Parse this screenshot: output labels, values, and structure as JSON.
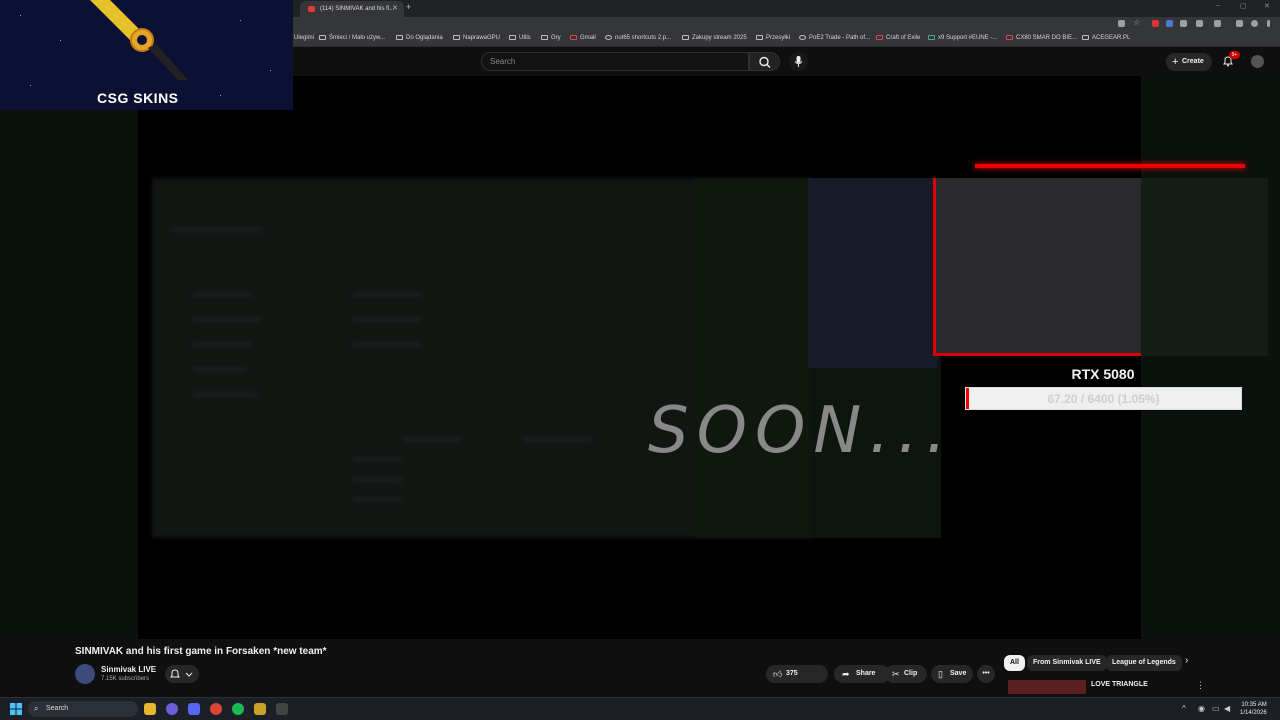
{
  "browser": {
    "tab_title": "(114) SINMIVAK and his fi...",
    "bookmarks": [
      "Ulegimi",
      "Śmieci / Mało używ...",
      "Do Oglądania",
      "NaprawaGPU",
      "Utils",
      "Gry",
      "Gmail",
      "nut65 shortcuts 2.p...",
      "Zakupy stream 2025",
      "Przesyłki",
      "PoE2 Trade - Path of...",
      "Craft of Exile",
      "x9 Support #EUNE -...",
      "CX80 SMAR DO BIE...",
      "ACEGEAR.PL"
    ]
  },
  "header": {
    "search_placeholder": "Search",
    "create_label": "Create",
    "notification_count": "9+"
  },
  "overlay": {
    "soon_text": "SOON...",
    "goal_title": "RTX 5080",
    "goal_text": "67.20 / 6400 (1.05%)",
    "goal_percent": 1.05,
    "brand": "CSG SKINS"
  },
  "video": {
    "title": "SINMIVAK and his first game in Forsaken *new team*",
    "channel_name": "Sinmivak LIVE",
    "subscribers": "7.15K subscribers",
    "likes": "375",
    "share_label": "Share",
    "clip_label": "Clip",
    "save_label": "Save"
  },
  "chips": [
    "All",
    "From Sinmivak LIVE",
    "League of Legends"
  ],
  "related": {
    "title": "LOVE TRIANGLE"
  },
  "taskbar": {
    "search_label": "Search",
    "time": "10:35 AM",
    "date": "1/14/2026"
  }
}
